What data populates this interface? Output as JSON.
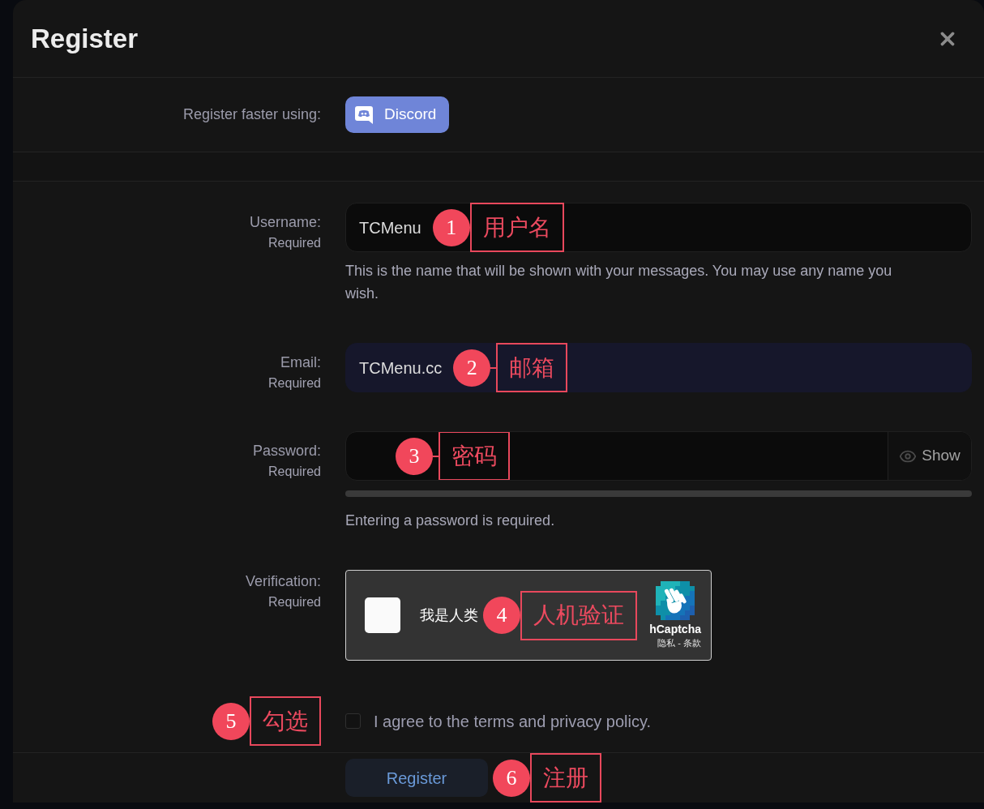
{
  "dialog": {
    "title": "Register"
  },
  "quick_register": {
    "label": "Register faster using:",
    "button": "Discord"
  },
  "fields": [
    {
      "kind": "text",
      "label": "Username:",
      "note": "Required",
      "value": "TCMenu",
      "autofilled": false,
      "hint": "This is the name that will be shown with your messages. You may use any name you wish.",
      "annotation": {
        "number": "1",
        "text": "用户名",
        "connector": false
      }
    },
    {
      "kind": "text",
      "label": "Email:",
      "note": "Required",
      "value": "TCMenu.cc",
      "autofilled": true,
      "annotation": {
        "number": "2",
        "text": "邮箱",
        "connector": true
      }
    },
    {
      "kind": "password",
      "label": "Password:",
      "note": "Required",
      "toggle": "Show",
      "hint": "Entering a password is required.",
      "annotation": {
        "number": "3",
        "text": "密码",
        "connector": true
      }
    },
    {
      "kind": "captcha",
      "label": "Verification:",
      "note": "Required",
      "checked": false,
      "prompt": "我是人类",
      "brand": "hCaptcha",
      "links": [
        "隐私",
        "条款"
      ],
      "separator": "-",
      "annotation": {
        "number": "4",
        "text": "人机验证",
        "connector": false
      }
    }
  ],
  "terms": {
    "checked": false,
    "text": "I agree to the terms and privacy policy.",
    "annotation": {
      "number": "5",
      "text": "勾选",
      "connector": false
    }
  },
  "submit": {
    "label": "Register",
    "annotation": {
      "number": "6",
      "text": "注册",
      "connector": false
    }
  }
}
